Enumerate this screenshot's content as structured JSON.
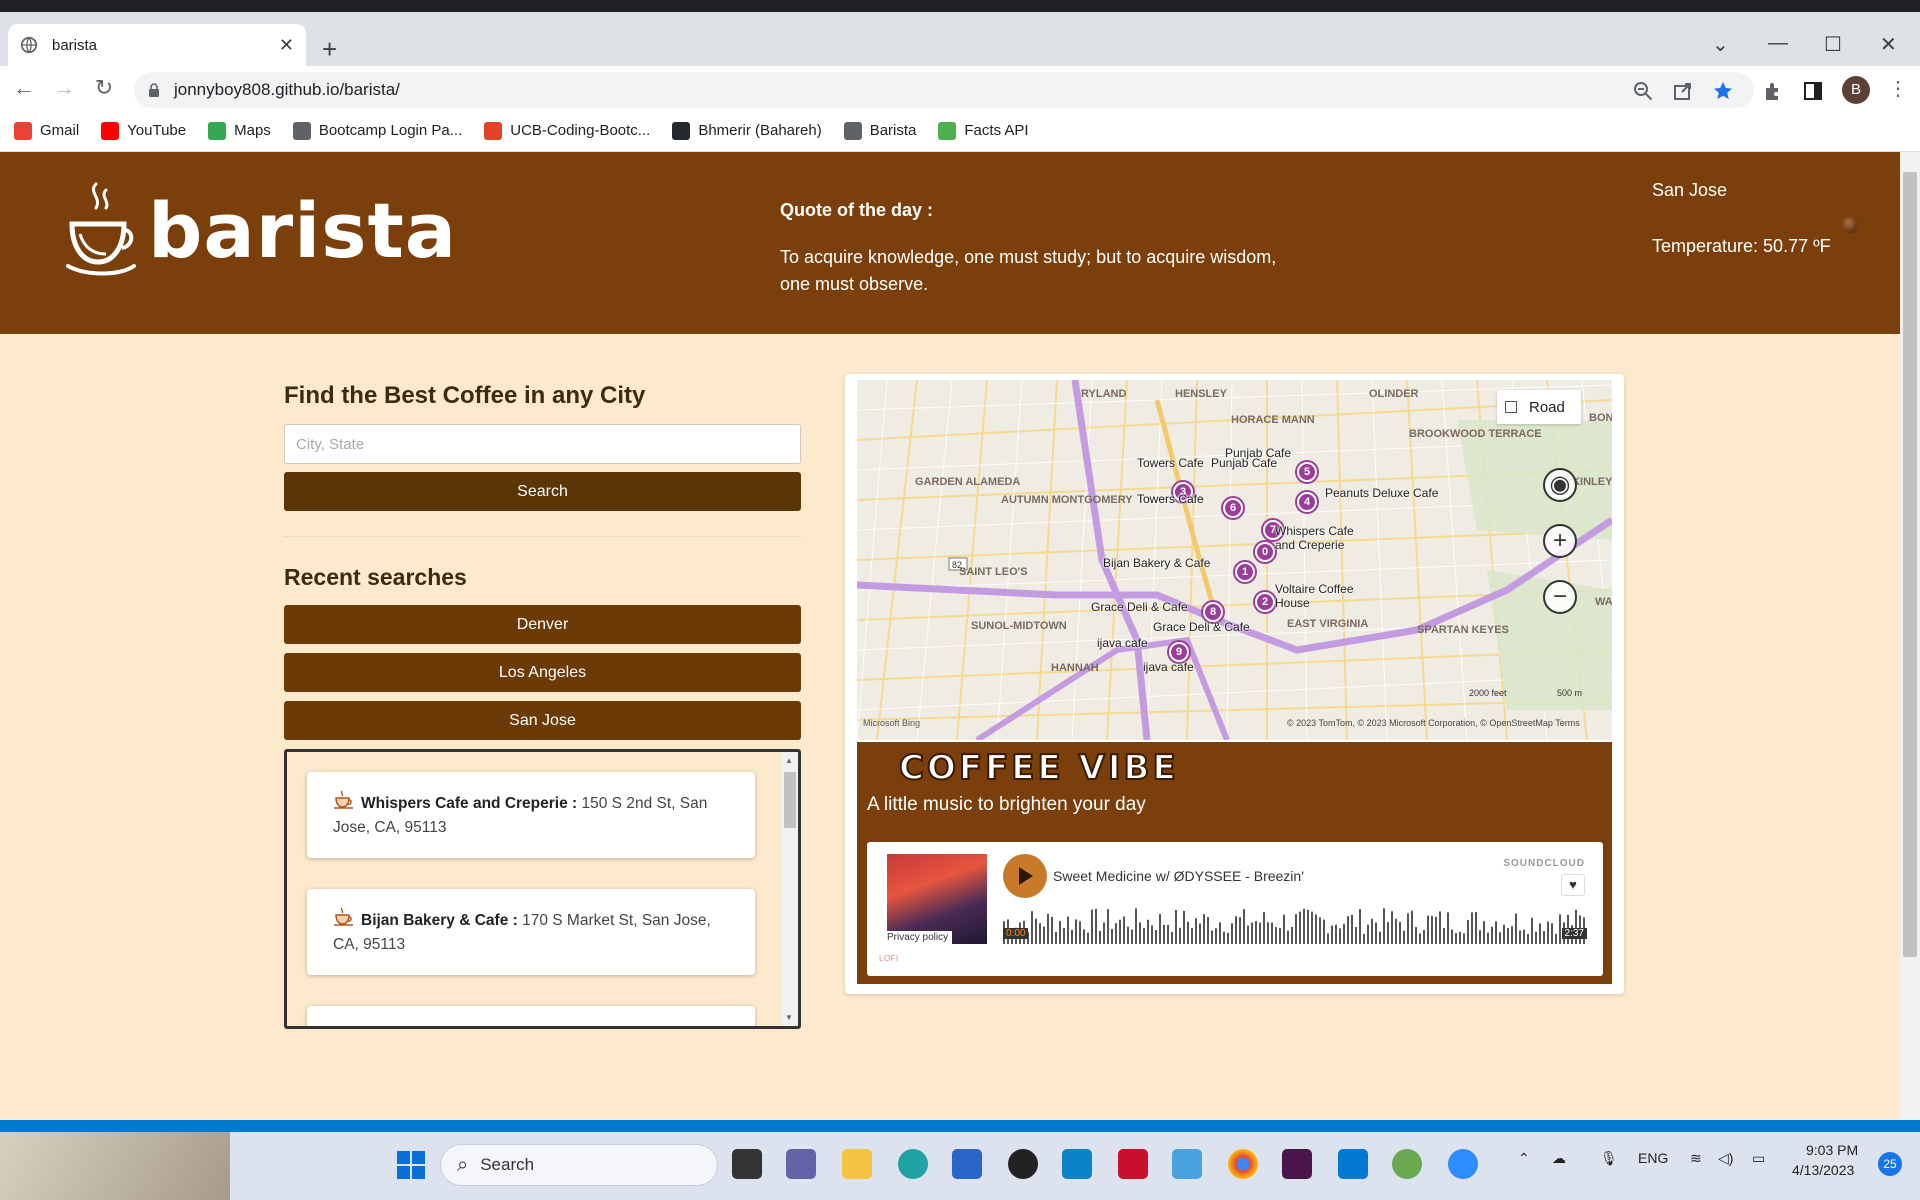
{
  "browser": {
    "tab_title": "barista",
    "address": "jonnyboy808.github.io/barista/",
    "profile_initial": "B",
    "bookmarks": [
      {
        "label": "Gmail",
        "color": "#ea4335"
      },
      {
        "label": "YouTube",
        "color": "#ff0000"
      },
      {
        "label": "Maps",
        "color": "#34a853"
      },
      {
        "label": "Bootcamp Login Pa...",
        "color": "#5f6368"
      },
      {
        "label": "UCB-Coding-Bootc...",
        "color": "#e24329"
      },
      {
        "label": "Bhmerir (Bahareh)",
        "color": "#24292e"
      },
      {
        "label": "Barista",
        "color": "#5f6368"
      },
      {
        "label": "Facts API",
        "color": "#4caf50"
      }
    ]
  },
  "header": {
    "logo_text": "barista",
    "quote_title": "Quote of the day :",
    "quote": "To acquire knowledge, one must study; but to acquire wisdom, one must observe.",
    "city": "San Jose",
    "temperature": "Temperature: 50.77 ºF"
  },
  "search": {
    "title": "Find the Best Coffee in any City",
    "placeholder": "City, State",
    "button": "Search"
  },
  "recent": {
    "title": "Recent searches",
    "items": [
      "Denver",
      "Los Angeles",
      "San Jose"
    ]
  },
  "results": [
    {
      "name": "Whispers Cafe and Creperie :",
      "address": "150 S 2nd St, San Jose, CA, 95113"
    },
    {
      "name": "Bijan Bakery & Cafe :",
      "address": "170 S Market St, San Jose, CA, 95113"
    }
  ],
  "map": {
    "style_button": "Road",
    "neighborhoods": [
      "RYLAND",
      "HENSLEY",
      "HORACE MANN",
      "OLINDER",
      "BONITA",
      "BROOKWOOD TERRACE",
      "MCKINLEY",
      "GARDEN ALAMEDA",
      "AUTUMN MONTGOMERY",
      "SAINT LEO'S",
      "SUNOL-MIDTOWN",
      "HANNAH",
      "EAST VIRGINIA",
      "SPARTAN KEYES",
      "WALN"
    ],
    "pins": [
      {
        "num": "5",
        "label": "Punjab Cafe"
      },
      {
        "num": "3",
        "label": "Towers Cafe"
      },
      {
        "num": "6",
        "label": "Towers Cafe"
      },
      {
        "num": "4",
        "label": "Peanuts Deluxe Cafe"
      },
      {
        "num": "7",
        "label": ""
      },
      {
        "num": "0",
        "label": "Whispers Cafe and Creperie"
      },
      {
        "num": "1",
        "label": "Bijan Bakery & Cafe"
      },
      {
        "num": "2",
        "label": "Voltaire Coffee House"
      },
      {
        "num": "8",
        "label": "Grace Deli & Cafe"
      },
      {
        "num": "9",
        "label": "ijava cafe"
      }
    ],
    "attribution": "© 2023 TomTom, © 2023 Microsoft Corporation, © OpenStreetMap  Terms",
    "brand": "Microsoft Bing",
    "scale_ft": "2000 feet",
    "scale_m": "500 m"
  },
  "vibe": {
    "title": "COFFEE VIBE",
    "subtitle": "A little music to brighten your day",
    "track": "Sweet Medicine w/ ØDYSSEE - Breezin'",
    "brand": "SOUNDCLOUD",
    "privacy": "Privacy policy",
    "time_start": "0:00",
    "time_end": "2:37",
    "tag": "LOFI"
  },
  "taskbar": {
    "search": "Search",
    "lang": "ENG",
    "time": "9:03 PM",
    "date": "4/13/2023",
    "badge": "25"
  },
  "colors": {
    "header_bg": "#7a3f0a",
    "page_bg": "#fde9cc",
    "button_bg": "#6b3a06",
    "pin": "#9b3c9b"
  }
}
